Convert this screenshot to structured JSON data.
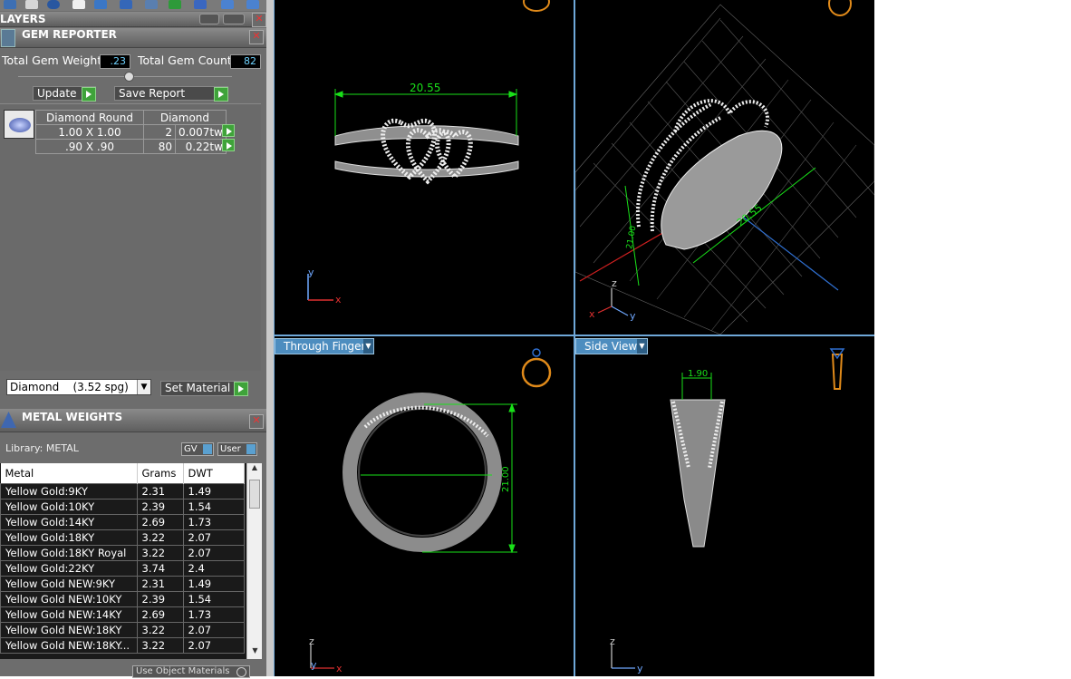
{
  "layers": {
    "title": "LAYERS"
  },
  "gem_reporter": {
    "title": "GEM REPORTER",
    "total_weight_label": "Total Gem Weight",
    "total_weight_value": ".23",
    "total_count_label": "Total Gem Count",
    "total_count_value": "82",
    "update_label": "Update",
    "save_report_label": "Save Report",
    "table_header": {
      "shape": "Diamond Round",
      "material": "Diamond"
    },
    "rows": [
      {
        "size": "1.00 X 1.00",
        "count": "2",
        "weight": "0.007tw"
      },
      {
        "size": ".90 X .90",
        "count": "80",
        "weight": "0.22tw"
      }
    ],
    "material_select": "Diamond    (3.52 spg)",
    "set_material_label": "Set Material"
  },
  "metal_weights": {
    "title": "METAL WEIGHTS",
    "library_label": "Library: METAL",
    "gv_label": "GV",
    "user_label": "User",
    "columns": [
      "Metal",
      "Grams",
      "DWT"
    ],
    "rows": [
      [
        "Yellow Gold:9KY",
        "2.31",
        "1.49"
      ],
      [
        "Yellow Gold:10KY",
        "2.39",
        "1.54"
      ],
      [
        "Yellow Gold:14KY",
        "2.69",
        "1.73"
      ],
      [
        "Yellow Gold:18KY",
        "3.22",
        "2.07"
      ],
      [
        "Yellow Gold:18KY Royal",
        "3.22",
        "2.07"
      ],
      [
        "Yellow Gold:22KY",
        "3.74",
        "2.4"
      ],
      [
        "Yellow Gold NEW:9KY",
        "2.31",
        "1.49"
      ],
      [
        "Yellow Gold NEW:10KY",
        "2.39",
        "1.54"
      ],
      [
        "Yellow Gold NEW:14KY",
        "2.69",
        "1.73"
      ],
      [
        "Yellow Gold NEW:18KY",
        "3.22",
        "2.07"
      ],
      [
        "Yellow Gold NEW:18KY...",
        "3.22",
        "2.07"
      ]
    ],
    "use_object_materials_label": "Use Object Materials"
  },
  "viewports": {
    "top": {
      "dimension": "20.55",
      "axis_y": "y",
      "axis_x": "x"
    },
    "perspective": {
      "dimension_a": "20.55",
      "dimension_b": "21.00",
      "axis_z": "z",
      "axis_x": "x",
      "axis_y": "y"
    },
    "front": {
      "label": "Through Finger",
      "dimension": "21.00",
      "axis_z": "z",
      "axis_y": "y",
      "axis_x": "x"
    },
    "side": {
      "label": "Side View",
      "dimension": "1.90",
      "axis_z": "z",
      "axis_y": "y"
    }
  },
  "colors": {
    "panel_bg": "#6d6d6d",
    "viewport_bg": "#000000",
    "viewport_border": "#6fa8d8",
    "dimension_green": "#19e019",
    "play_green": "#3fa33a",
    "value_blue": "#6fd3ff"
  }
}
